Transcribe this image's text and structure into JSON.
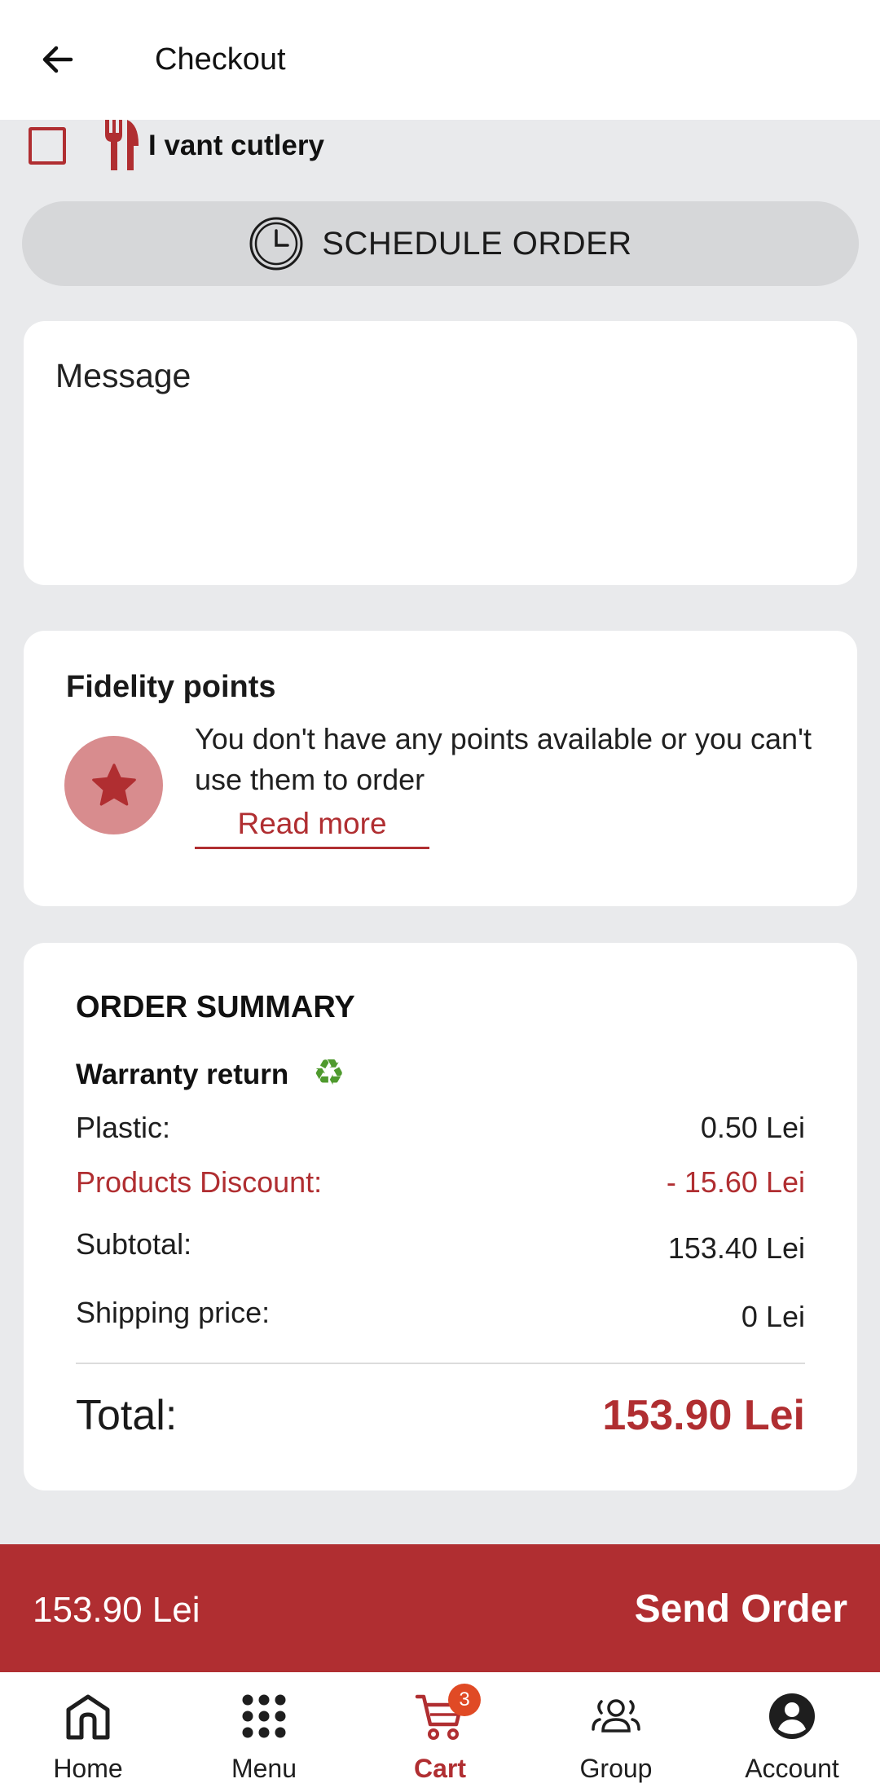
{
  "appbar": {
    "title": "Checkout"
  },
  "cutlery": {
    "label": "I vant cutlery",
    "checked": false
  },
  "schedule": {
    "label": "SCHEDULE ORDER"
  },
  "message": {
    "placeholder": "Message"
  },
  "fidelity": {
    "title": "Fidelity points",
    "text": "You don't have any points available or you can't use them to order",
    "read_more": "Read more"
  },
  "summary": {
    "title": "ORDER SUMMARY",
    "warranty_label": "Warranty return",
    "rows": [
      {
        "label": "Plastic:",
        "value": "0.50 Lei"
      },
      {
        "label": "Products Discount:",
        "value": "- 15.60 Lei"
      },
      {
        "label": "Subtotal:",
        "value": "153.40 Lei"
      },
      {
        "label": "Shipping price:",
        "value": "0 Lei"
      }
    ],
    "total_label": "Total:",
    "total_value": "153.90 Lei"
  },
  "order_bar": {
    "price": "153.90 Lei",
    "send_label": "Send Order"
  },
  "nav": {
    "items": [
      {
        "label": "Home",
        "icon": "home-icon"
      },
      {
        "label": "Menu",
        "icon": "grid-icon"
      },
      {
        "label": "Cart",
        "icon": "cart-icon",
        "active": true,
        "badge": "3"
      },
      {
        "label": "Group",
        "icon": "group-icon"
      },
      {
        "label": "Account",
        "icon": "account-icon"
      }
    ]
  },
  "colors": {
    "accent": "#b02e31",
    "badge": "#e04a25",
    "recycle": "#4f9a2e",
    "background": "#e9eaec"
  }
}
